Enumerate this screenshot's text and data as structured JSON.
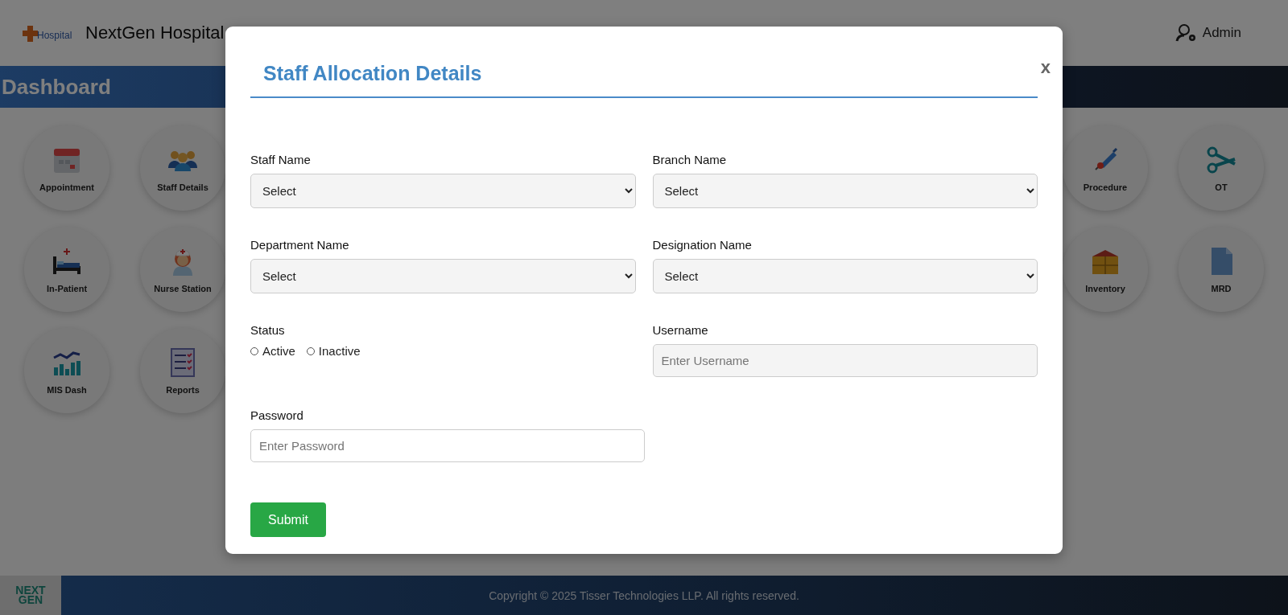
{
  "header": {
    "logo_text": "Hospital",
    "title": "NextGen Hospital",
    "user": "Admin"
  },
  "dashboard": {
    "title": "Dashboard"
  },
  "tiles_left": [
    {
      "label": "Appointment",
      "kind": "calendar"
    },
    {
      "label": "Staff Details",
      "kind": "people"
    },
    {
      "label": "In-Patient",
      "kind": "bed"
    },
    {
      "label": "Nurse Station",
      "kind": "nurse"
    },
    {
      "label": "MIS Dash",
      "kind": "chart"
    },
    {
      "label": "Reports",
      "kind": "report"
    }
  ],
  "tiles_right": [
    {
      "label": "Procedure",
      "kind": "syringe"
    },
    {
      "label": "OT",
      "kind": "scissors"
    },
    {
      "label": "Inventory",
      "kind": "boxes"
    },
    {
      "label": "MRD",
      "kind": "document"
    }
  ],
  "modal": {
    "title": "Staff Allocation Details",
    "close": "x",
    "fields": [
      {
        "label": "Staff Name",
        "kind": "select",
        "value": "Select"
      },
      {
        "label": "Branch Name",
        "kind": "select",
        "value": "Select"
      },
      {
        "label": "Department Name",
        "kind": "select",
        "value": "Select"
      },
      {
        "label": "Designation Name",
        "kind": "select",
        "value": "Select"
      },
      {
        "label": "Status",
        "kind": "radio",
        "options": [
          {
            "label": "Active",
            "selected": false
          },
          {
            "label": "Inactive",
            "selected": false
          }
        ]
      },
      {
        "label": "Username",
        "kind": "text",
        "placeholder": "Enter Username"
      },
      {
        "label": "Password",
        "kind": "password",
        "placeholder": "Enter Password"
      }
    ],
    "submit": "Submit"
  },
  "footer": {
    "logo_lines": [
      "NEXT",
      "GEN"
    ],
    "copyright": "Copyright © 2025 Tisser Technologies LLP. All rights reserved."
  }
}
